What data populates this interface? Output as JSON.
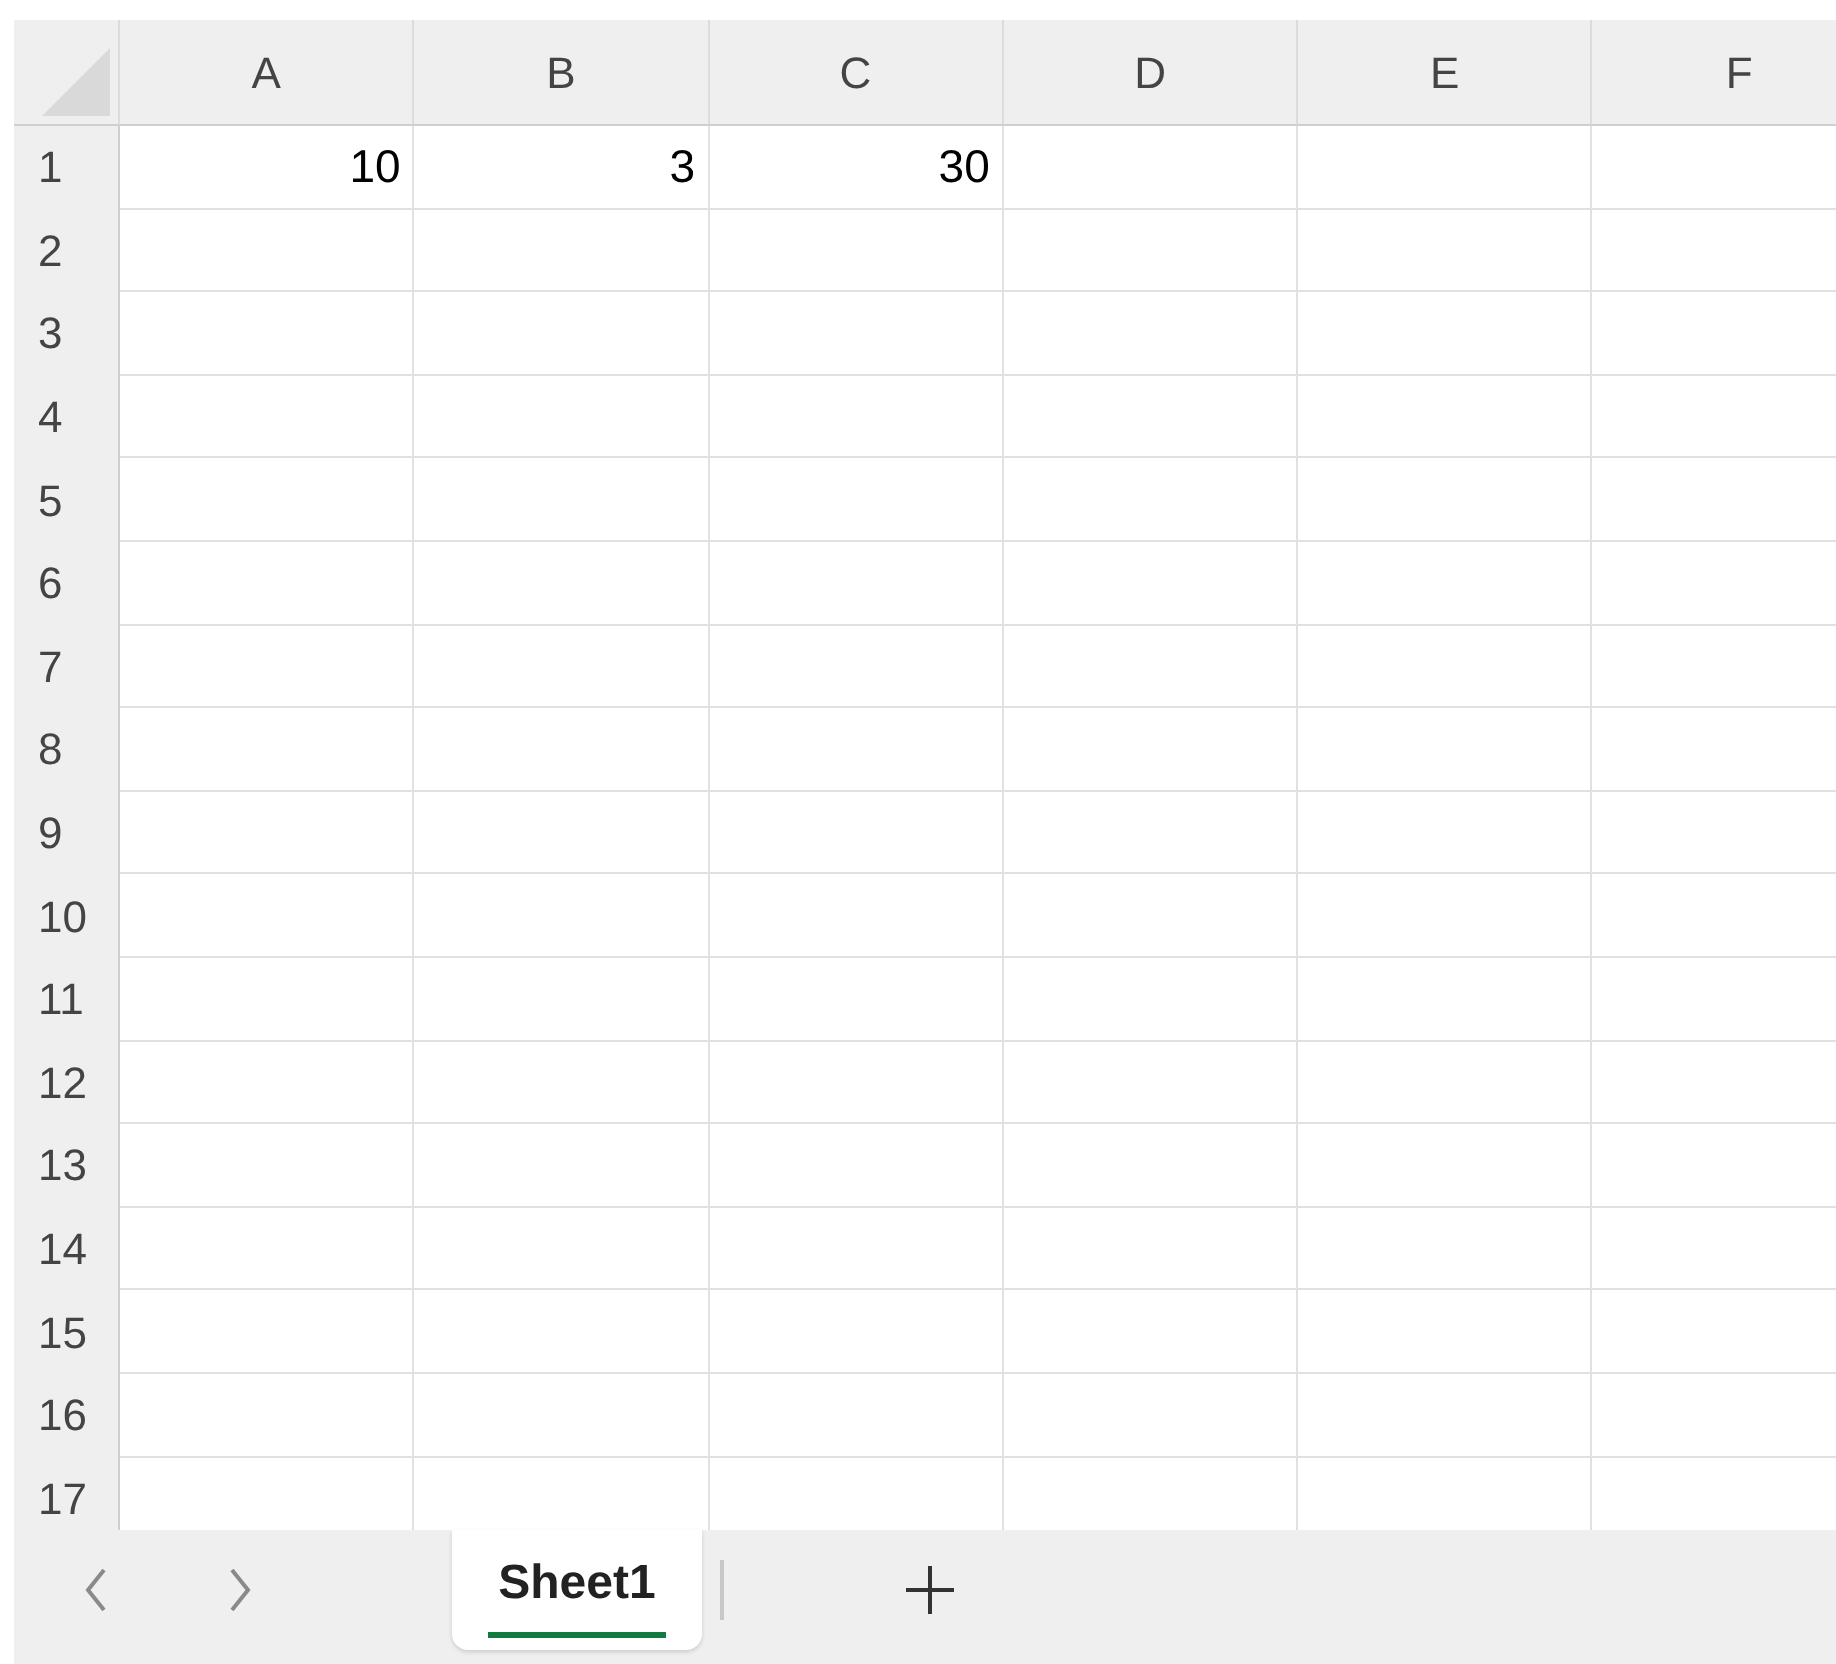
{
  "columns": [
    "A",
    "B",
    "C",
    "D",
    "E",
    "F"
  ],
  "rows": [
    {
      "number": "1",
      "cells": [
        "10",
        "3",
        "30"
      ]
    },
    {
      "number": "2"
    },
    {
      "number": "3"
    },
    {
      "number": "4"
    },
    {
      "number": "5"
    },
    {
      "number": "6"
    },
    {
      "number": "7"
    },
    {
      "number": "8"
    },
    {
      "number": "9"
    },
    {
      "number": "10"
    },
    {
      "number": "11"
    },
    {
      "number": "12"
    },
    {
      "number": "13"
    },
    {
      "number": "14"
    },
    {
      "number": "15"
    },
    {
      "number": "16"
    },
    {
      "number": "17"
    }
  ],
  "sheet_tabs": [
    {
      "label": "Sheet1",
      "selected": true
    }
  ]
}
